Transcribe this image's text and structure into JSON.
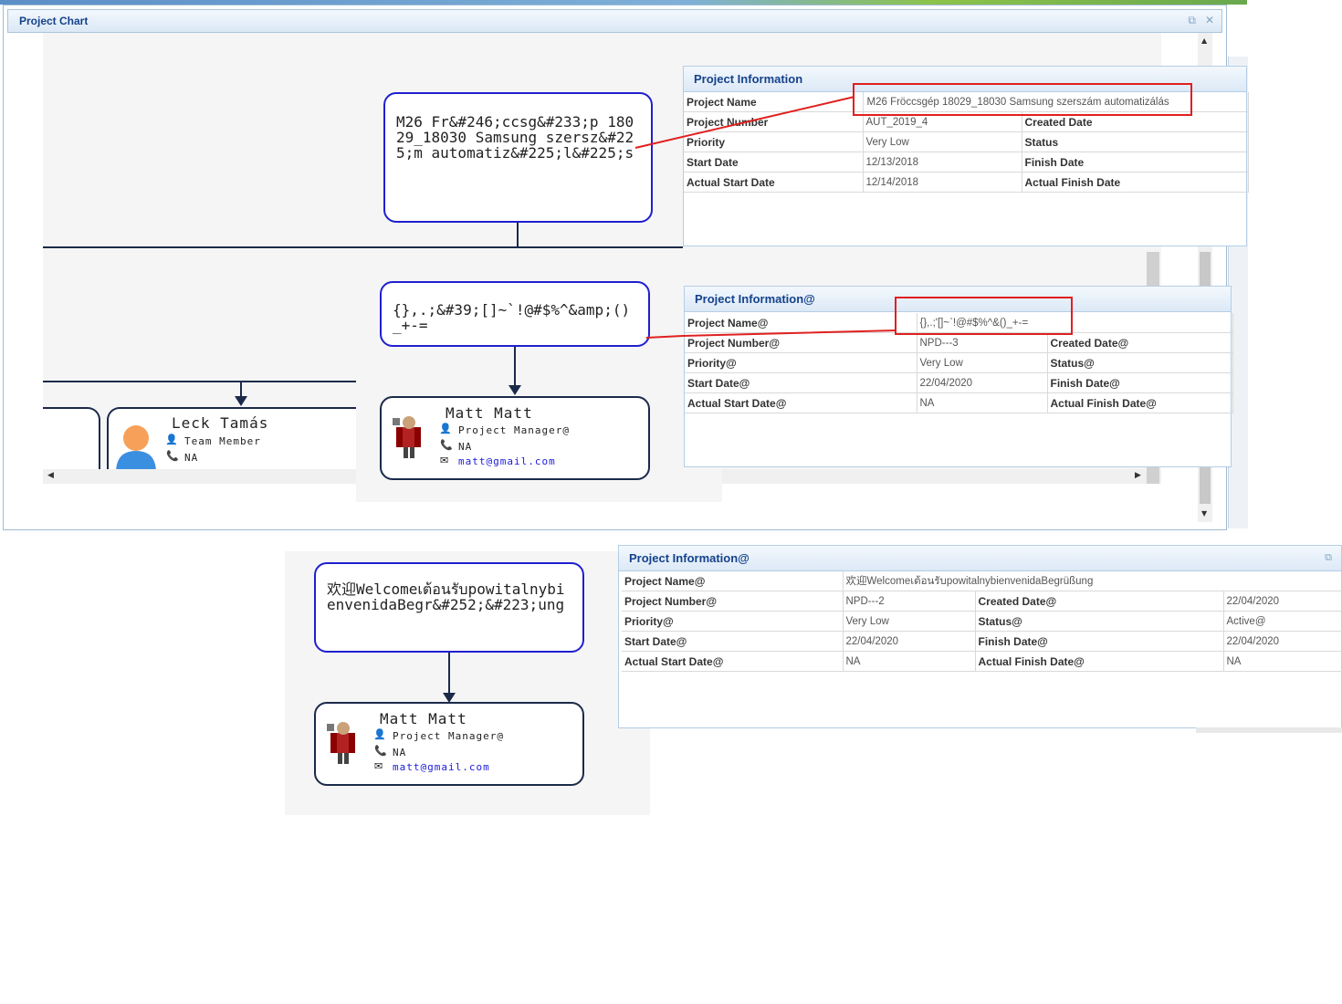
{
  "window": {
    "title": "Project Chart"
  },
  "chart1": {
    "root_node_text": "M26 Fr&#246;ccsg&#233;p 18029_18030 Samsung szersz&#225;m automatiz&#225;l&#225;s",
    "child_node_text": "{},.;&#39;[]~`!@#$%^&amp;()_+-=",
    "team_member": {
      "name": "Leck Tamás",
      "role": "Team Member",
      "phone": "NA"
    },
    "manager": {
      "name": "Matt Matt",
      "role": "Project Manager@",
      "phone": "NA",
      "email": "matt@gmail.com"
    }
  },
  "info1": {
    "title": "Project Information",
    "project_name_label": "Project Name",
    "project_name": "M26 Fröccsgép 18029_18030 Samsung szerszám automatizálás",
    "project_number_label": "Project Number",
    "project_number": "AUT_2019_4",
    "created_date_label": "Created Date",
    "priority_label": "Priority",
    "priority": "Very Low",
    "status_label": "Status",
    "start_date_label": "Start Date",
    "start_date": "12/13/2018",
    "finish_date_label": "Finish Date",
    "actual_start_label": "Actual Start Date",
    "actual_start": "12/14/2018",
    "actual_finish_label": "Actual Finish Date"
  },
  "info2": {
    "title": "Project Information@",
    "project_name_label": "Project Name@",
    "project_name": "{},.;'[]~`!@#$%^&()_+-=",
    "project_number_label": "Project Number@",
    "project_number": "NPD---3",
    "created_date_label": "Created Date@",
    "priority_label": "Priority@",
    "priority": "Very Low",
    "status_label": "Status@",
    "start_date_label": "Start Date@",
    "start_date": "22/04/2020",
    "finish_date_label": "Finish Date@",
    "actual_start_label": "Actual Start Date@",
    "actual_start": "NA",
    "actual_finish_label": "Actual Finish Date@"
  },
  "chart2": {
    "root_node_text": "欢迎Welcomeเต้อนรับpowitalnybienvenidaBegr&#252;&#223;ung",
    "manager": {
      "name": "Matt Matt",
      "role": "Project Manager@",
      "phone": "NA",
      "email": "matt@gmail.com"
    }
  },
  "info3": {
    "title": "Project Information@",
    "project_name_label": "Project Name@",
    "project_name": "欢迎Welcomeเต้อนรับpowitalnybienvenidaBegrüßung",
    "project_number_label": "Project Number@",
    "project_number": "NPD---2",
    "created_date_label": "Created Date@",
    "created_date": "22/04/2020",
    "priority_label": "Priority@",
    "priority": "Very Low",
    "status_label": "Status@",
    "status": "Active@",
    "start_date_label": "Start Date@",
    "start_date": "22/04/2020",
    "finish_date_label": "Finish Date@",
    "finish_date": "22/04/2020",
    "actual_start_label": "Actual Start Date@",
    "actual_start": "NA",
    "actual_finish_label": "Actual Finish Date@",
    "actual_finish": "NA"
  },
  "colors": {
    "node_border": "#1f1fd0",
    "highlight": "#e02020",
    "header_text": "#15428b"
  }
}
